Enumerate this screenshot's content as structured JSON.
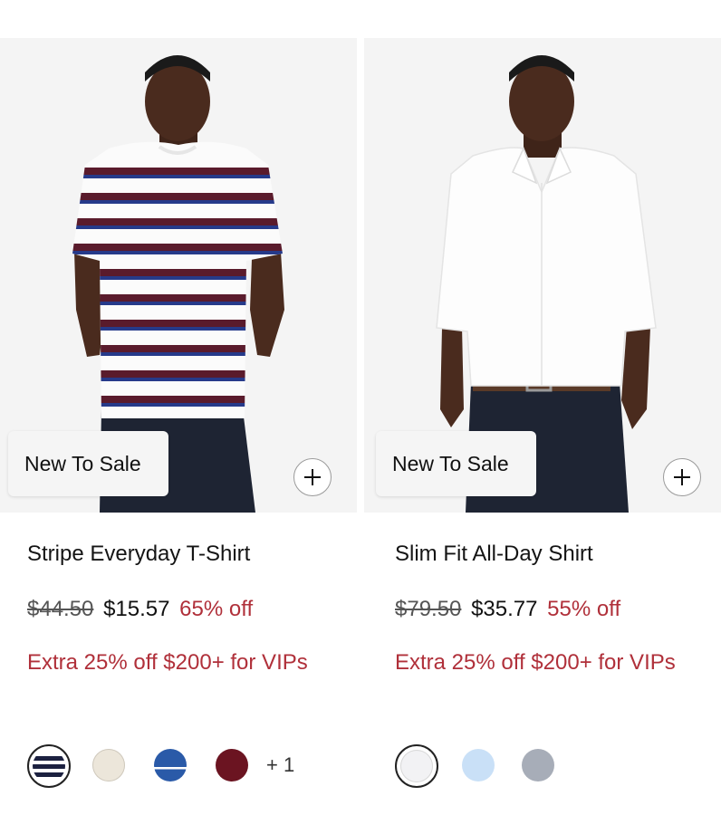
{
  "products": [
    {
      "badge": "New To Sale",
      "name": "Stripe Everyday T-Shirt",
      "original_price": "$44.50",
      "sale_price": "$15.57",
      "discount": "65% off",
      "promo": "Extra 25% off $200+ for VIPs",
      "swatches": [
        "navy-red stripe",
        "cream",
        "blue",
        "burgundy"
      ],
      "more_colors": "+ 1"
    },
    {
      "badge": "New To Sale",
      "name": "Slim Fit All-Day Shirt",
      "original_price": "$79.50",
      "sale_price": "$35.77",
      "discount": "55% off",
      "promo": "Extra 25% off $200+ for VIPs",
      "swatches": [
        "white",
        "light blue",
        "grey"
      ]
    }
  ],
  "colors": {
    "promo_red": "#b0303a",
    "photo_bg": "#f4f4f4"
  }
}
